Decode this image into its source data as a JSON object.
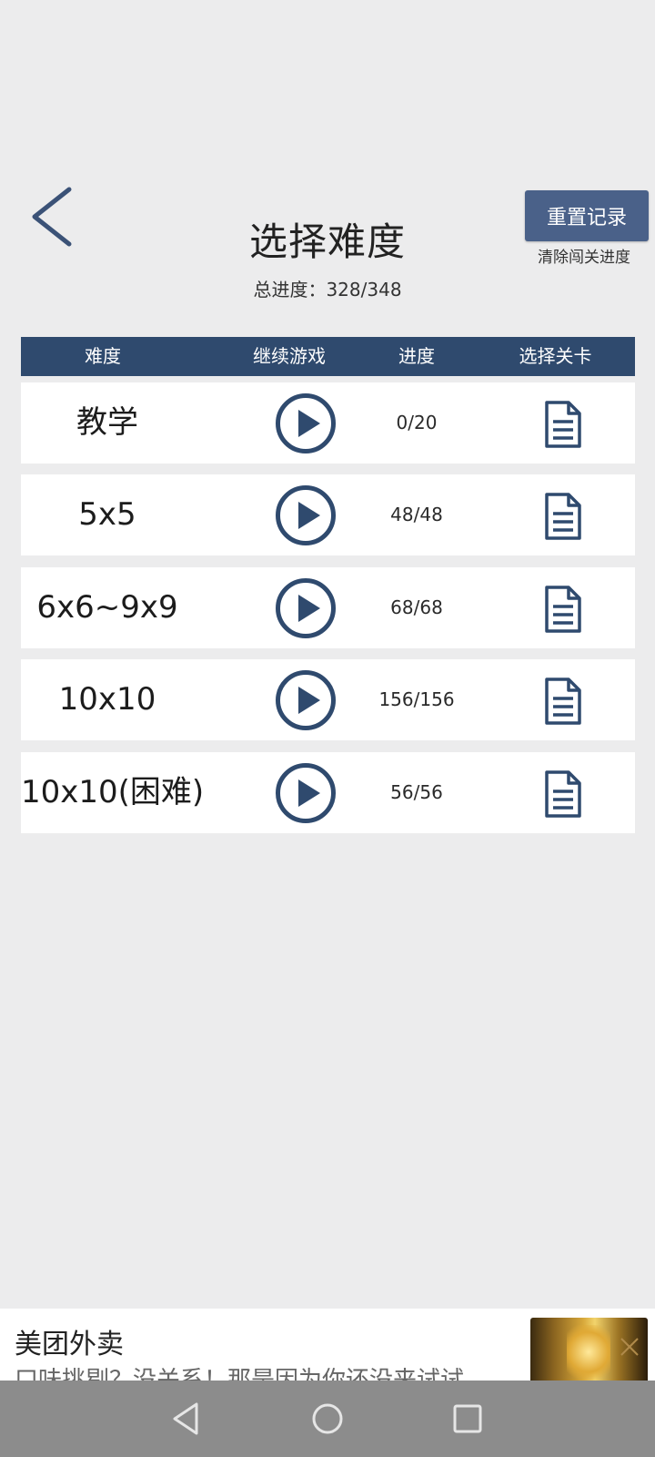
{
  "header": {
    "title": "选择难度",
    "progress_text": "总进度：328/348",
    "reset_label": "重置记录",
    "reset_hint": "清除闯关进度",
    "back_icon": "chevron-left-icon"
  },
  "table": {
    "columns": [
      "难度",
      "继续游戏",
      "进度",
      "选择关卡"
    ],
    "rows": [
      {
        "name": "教学",
        "progress": "0/20"
      },
      {
        "name": "5x5",
        "progress": "48/48"
      },
      {
        "name": "6x6~9x9",
        "progress": "68/68"
      },
      {
        "name": "10x10",
        "progress": "156/156"
      },
      {
        "name": "10x10(困难)",
        "progress": "56/56"
      }
    ],
    "play_icon": "play-circle-icon",
    "doc_icon": "document-icon"
  },
  "ad": {
    "title": "美团外卖",
    "text": "口味挑剔？没关系！那是因为你还没来试试..."
  },
  "colors": {
    "accent": "#2f4a6e",
    "reset_button": "#4a6189",
    "background": "#ececed"
  }
}
